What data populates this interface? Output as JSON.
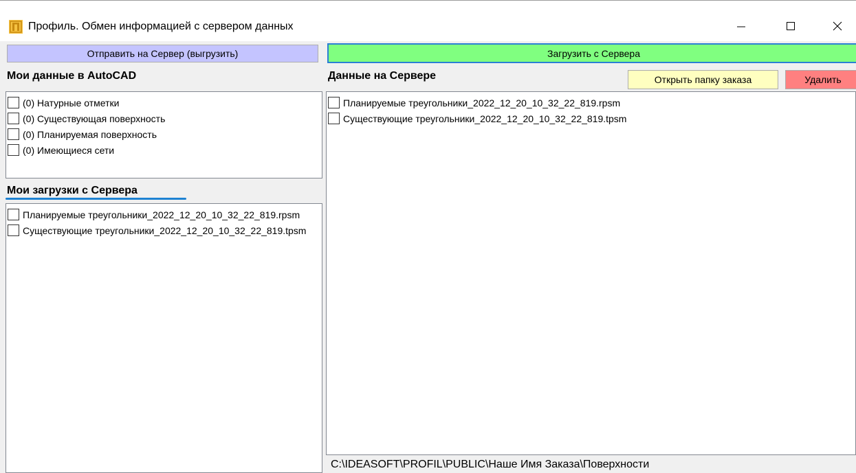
{
  "window": {
    "title": "Профиль. Обмен информацией с сервером данных"
  },
  "toolbar": {
    "upload_label": "Отправить на Сервер (выгрузить)",
    "download_label": "Загрузить с Сервера",
    "open_folder_label": "Открыть папку заказа",
    "delete_label": "Удалить"
  },
  "left": {
    "my_data_heading": "Мои данные в AutoCAD",
    "my_data_items": [
      "(0) Натурные отметки",
      "(0) Существующая поверхность",
      "(0) Планируемая поверхность",
      "(0) Имеющиеся сети"
    ],
    "downloads_heading": "Мои загрузки с Сервера",
    "download_items": [
      "Планируемые треугольники_2022_12_20_10_32_22_819.rpsm",
      "Существующие треугольники_2022_12_20_10_32_22_819.tpsm"
    ]
  },
  "right": {
    "server_heading": "Данные на Сервере",
    "server_items": [
      "Планируемые треугольники_2022_12_20_10_32_22_819.rpsm",
      "Существующие треугольники_2022_12_20_10_32_22_819.tpsm"
    ]
  },
  "status": {
    "path": "C:\\IDEASOFT\\PROFIL\\PUBLIC\\Наше Имя Заказа\\Поверхности"
  },
  "colors": {
    "upload_button": "#c4c4ff",
    "download_button": "#80ff80",
    "open_folder_button": "#ffffc0",
    "delete_button": "#ff8080",
    "accent": "#1e82d2"
  }
}
